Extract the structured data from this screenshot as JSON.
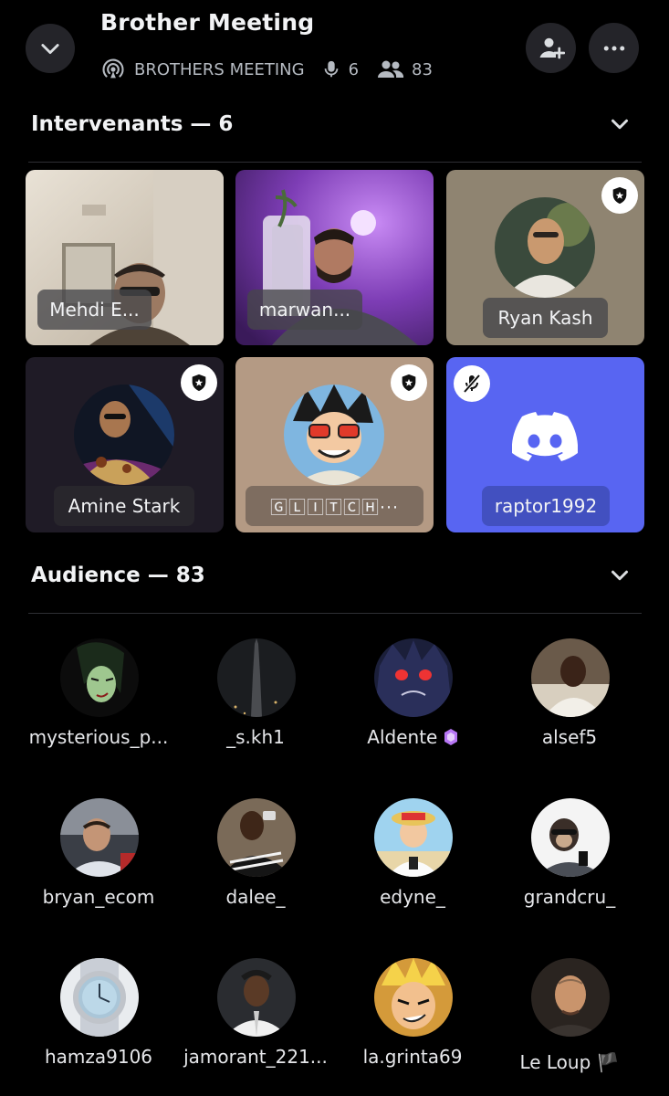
{
  "header": {
    "title": "Brother Meeting",
    "stage_name": "BROTHERS MEETING",
    "speaker_count": "6",
    "listener_count": "83"
  },
  "speakers_section": {
    "label": "Intervenants — 6"
  },
  "speakers": [
    {
      "name": "Mehdi E...",
      "moderator": false
    },
    {
      "name": "marwan...",
      "moderator": false
    },
    {
      "name": "Ryan Kash",
      "moderator": true
    },
    {
      "name": "Amine Stark",
      "moderator": true
    },
    {
      "name": "🄶🄻🄸🅃🄲🄷···",
      "moderator": true
    },
    {
      "name": "raptor1992",
      "moderator": false,
      "muted": true
    }
  ],
  "audience_section": {
    "label": "Audience — 83"
  },
  "audience": [
    {
      "name": "mysterious_p..."
    },
    {
      "name": "_s.kh1"
    },
    {
      "name": "Aldente"
    },
    {
      "name": "alsef5"
    },
    {
      "name": "bryan_ecom"
    },
    {
      "name": "dalee_"
    },
    {
      "name": "edyne_"
    },
    {
      "name": "grandcru_"
    },
    {
      "name": "hamza9106"
    },
    {
      "name": "jamorant_221..."
    },
    {
      "name": "la.grinta69"
    },
    {
      "name": "Le Loup 🏴"
    }
  ],
  "colors": {
    "background": "#000000",
    "discord_blurple": "#5865f2",
    "muted_text": "#b5bac1",
    "nitro_badge": "#b776f5"
  }
}
